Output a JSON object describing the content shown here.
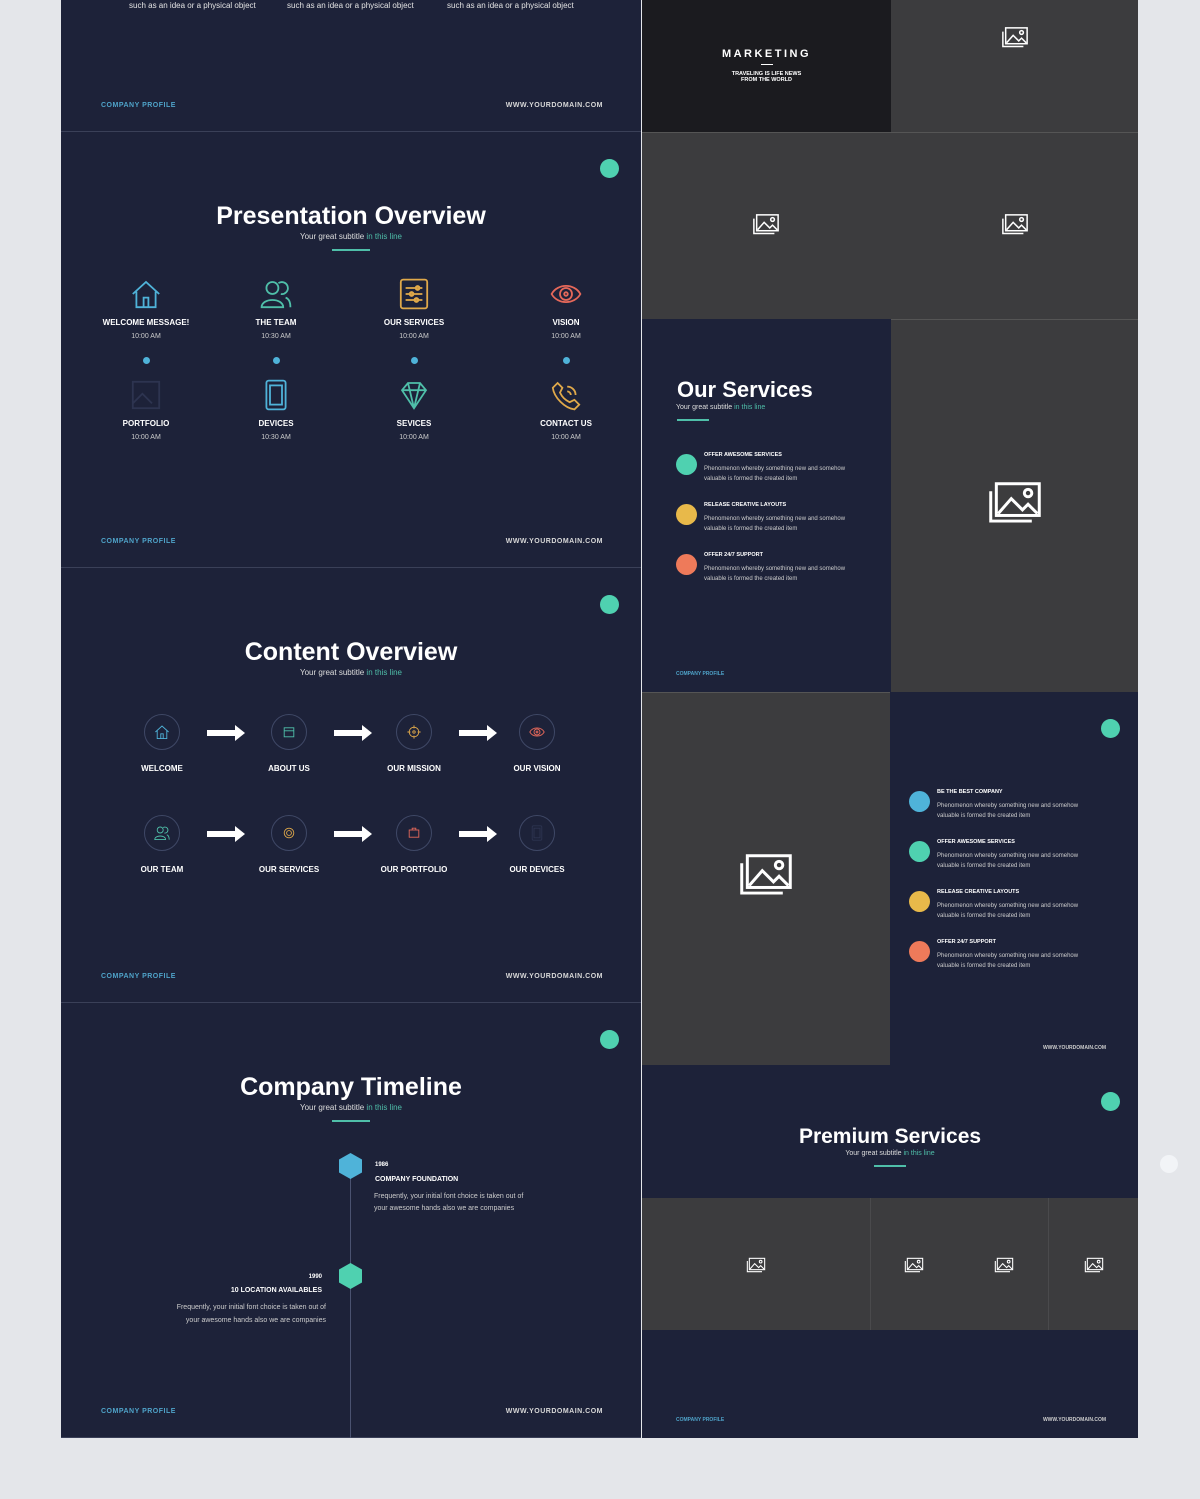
{
  "footer": {
    "left": "COMPANY PROFILE",
    "right": "WWW.YOURDOMAIN.COM"
  },
  "top_slide": {
    "captions": [
      "such as an idea or a physical object",
      "such as an idea or a physical object",
      "such as an idea or a physical object"
    ]
  },
  "marketing": {
    "title": "MARKETING",
    "line1": "TRAVELING IS LIFE NEWS",
    "line2": "FROM THE WORLD"
  },
  "subtitle": {
    "main": "Your great subtitle",
    "accent": "in this line"
  },
  "presentation_overview": {
    "title": "Presentation Overview",
    "items": [
      {
        "label": "WELCOME MESSAGE!",
        "time": "10:00 AM",
        "icon": "house-icon",
        "color": "#4fb3d9"
      },
      {
        "label": "THE TEAM",
        "time": "10:30 AM",
        "icon": "users-icon",
        "color": "#4fbfa9"
      },
      {
        "label": "OUR SERVICES",
        "time": "10:00 AM",
        "icon": "sliders-icon",
        "color": "#e0a94a"
      },
      {
        "label": "VISION",
        "time": "10:00 AM",
        "icon": "eye-icon",
        "color": "#e5685a"
      },
      {
        "label": "PORTFOLIO",
        "time": "10:00 AM",
        "icon": "image-icon",
        "color": "#2d3450"
      },
      {
        "label": "DEVICES",
        "time": "10:30 AM",
        "icon": "tablet-icon",
        "color": "#4fb3d9"
      },
      {
        "label": "SEVICES",
        "time": "10:00 AM",
        "icon": "diamond-icon",
        "color": "#4fbfa9"
      },
      {
        "label": "CONTACT US",
        "time": "10:00 AM",
        "icon": "phone-icon",
        "color": "#e0a94a"
      }
    ]
  },
  "content_overview": {
    "title": "Content Overview",
    "items": [
      {
        "label": "WELCOME",
        "icon": "house-icon",
        "color": "#4fb3d9"
      },
      {
        "label": "ABOUT US",
        "icon": "store-icon",
        "color": "#4fbfa9"
      },
      {
        "label": "OUR MISSION",
        "icon": "target-icon",
        "color": "#e0a94a"
      },
      {
        "label": "OUR VISION",
        "icon": "eye-icon",
        "color": "#e5685a"
      },
      {
        "label": "OUR TEAM",
        "icon": "users-icon",
        "color": "#4fbfa9"
      },
      {
        "label": "OUR SERVICES",
        "icon": "lifebuoy-icon",
        "color": "#e0a94a"
      },
      {
        "label": "OUR PORTFOLIO",
        "icon": "briefcase-icon",
        "color": "#e5685a"
      },
      {
        "label": "OUR DEVICES",
        "icon": "tablet-icon",
        "color": "#2d3450"
      }
    ]
  },
  "timeline": {
    "title": "Company Timeline",
    "events": [
      {
        "year": "1986",
        "title": "COMPANY FOUNDATION",
        "text1": "Frequently, your initial font choice is taken out of",
        "text2": "your awesome hands also we are companies",
        "icon": "house-icon",
        "color": "#4fb3d9"
      },
      {
        "year": "1990",
        "title": "10 LOCATION AVAILABLES",
        "text1": "Frequently, your initial font choice is taken out of",
        "text2": "your awesome hands also we are companies",
        "icon": "location-pin-icon",
        "color": "#4fd1b0"
      }
    ]
  },
  "our_services": {
    "title": "Our Services",
    "items": [
      {
        "title": "OFFER AWESOME SERVICES",
        "text1": "Phenomenon whereby something new and somehow",
        "text2": "valuable is formed the created item",
        "color": "#4fd1b0"
      },
      {
        "title": "RELEASE CREATIVE LAYOUTS",
        "text1": "Phenomenon whereby something new and somehow",
        "text2": "valuable is formed the created item",
        "color": "#e8b94a"
      },
      {
        "title": "OFFER 24/7 SUPPORT",
        "text1": "Phenomenon whereby something new and somehow",
        "text2": "valuable is formed the created item",
        "color": "#ee7a5a"
      }
    ]
  },
  "services_list": {
    "items": [
      {
        "title": "BE THE BEST COMPANY",
        "text1": "Phenomenon whereby something new and somehow",
        "text2": "valuable is formed the created item",
        "color": "#4fb3d9"
      },
      {
        "title": "OFFER AWESOME SERVICES",
        "text1": "Phenomenon whereby something new and somehow",
        "text2": "valuable is formed the created item",
        "color": "#4fd1b0"
      },
      {
        "title": "RELEASE CREATIVE LAYOUTS",
        "text1": "Phenomenon whereby something new and somehow",
        "text2": "valuable is formed the created item",
        "color": "#e8b94a"
      },
      {
        "title": "OFFER 24/7 SUPPORT",
        "text1": "Phenomenon whereby something new and somehow",
        "text2": "valuable is formed the created item",
        "color": "#ee7a5a"
      }
    ]
  },
  "premium": {
    "title": "Premium Services"
  },
  "colors": {
    "navy": "#1d2239",
    "gray": "#3c3c3e",
    "accent": "#4fbfa9",
    "blue": "#4fb3d9"
  }
}
